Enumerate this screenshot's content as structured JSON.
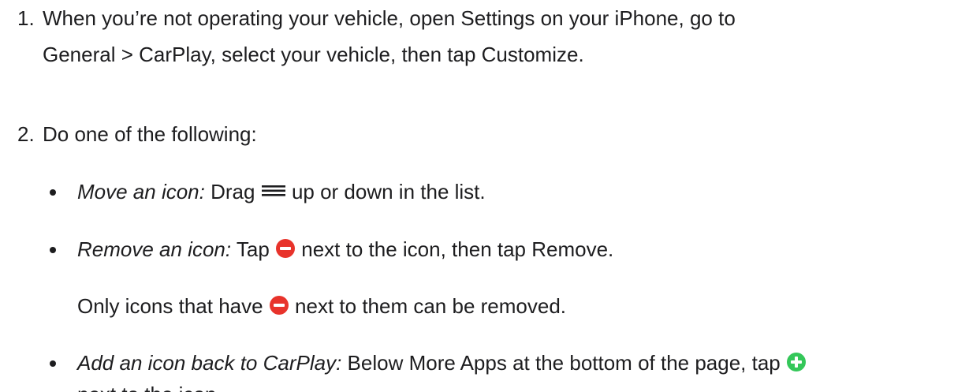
{
  "steps": [
    {
      "number": "1.",
      "line1": "When you’re not operating your vehicle, open Settings on your iPhone, go to",
      "line2": "General > CarPlay, select your vehicle, then tap Customize."
    },
    {
      "number": "2.",
      "text": "Do one of the following:"
    }
  ],
  "bullets": {
    "move": {
      "label": "Move an icon:",
      "before": "Drag",
      "icon": "reorder-handle-icon",
      "after": "up or down in the list."
    },
    "remove": {
      "label": "Remove an icon:",
      "before": "Tap",
      "icon": "remove-minus-icon",
      "after": "next to the icon, then tap Remove."
    },
    "remove_note": {
      "before": "Only icons that have",
      "icon": "remove-minus-icon",
      "after": "next to them can be removed."
    },
    "add": {
      "label": "Add an icon back to CarPlay:",
      "before": "Below More Apps at the bottom of the page, tap",
      "icon": "add-plus-icon",
      "line2": "next to the icon."
    }
  },
  "colors": {
    "text": "#1d1d1f",
    "remove_red": "#e8332b",
    "add_green": "#34c759"
  }
}
